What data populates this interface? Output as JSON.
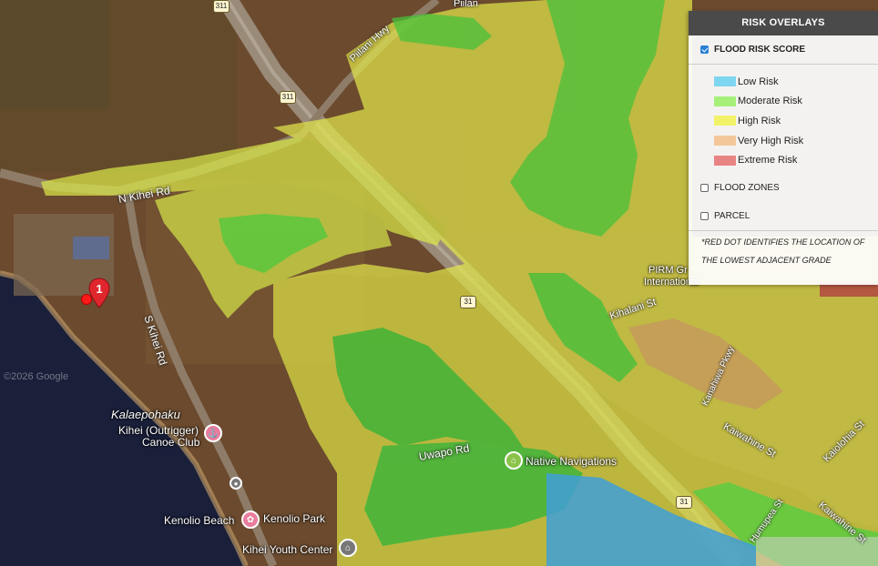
{
  "panel": {
    "title": "RISK OVERLAYS",
    "flood_risk": {
      "label": "FLOOD RISK SCORE",
      "checked": true
    },
    "legend": [
      {
        "label": "Low Risk",
        "color": "#7fd6f0"
      },
      {
        "label": "Moderate Risk",
        "color": "#a6f07a"
      },
      {
        "label": "High Risk",
        "color": "#f2f26a"
      },
      {
        "label": "Very High Risk",
        "color": "#f4c79a"
      },
      {
        "label": "Extreme Risk",
        "color": "#e98484"
      }
    ],
    "flood_zones": {
      "label": "FLOOD ZONES",
      "checked": false
    },
    "parcel": {
      "label": "PARCEL",
      "checked": false
    },
    "note_line1": "*RED DOT IDENTIFIES THE LOCATION OF",
    "note_line2": "THE LOWEST ADJACENT GRADE"
  },
  "map": {
    "marker_number": "1",
    "google_attribution": "©2026 Google",
    "place_labels": {
      "kalaepohaku": "Kalaepohaku",
      "canoe_club": "Kihei (Outrigger) Canoe Club",
      "canoe_club_line1": "Kihei (Outrigger)",
      "canoe_club_line2": "Canoe Club",
      "kenolio_beach": "Kenolio Beach",
      "kenolio_park": "Kenolio Park",
      "youth_center": "Kihei Youth Center",
      "native_navigations": "Native Navigations",
      "pirm": "PIRM Gr... International",
      "pirm_line1": "PIRM Gr",
      "pirm_line2": "International"
    },
    "roads": {
      "piilani_hwy": "Piilani Hwy",
      "piilani_top": "Piilan",
      "n_kihei_rd": "N Kihei Rd",
      "s_kihei_rd": "S Kihei Rd",
      "uwapo_rd": "Uwapo Rd",
      "kihalani": "Kihalani St",
      "kanahiwa": "Kanahiwa Pkwy",
      "kaiwahine1": "Kaiwahine St",
      "kaiwahine2": "Kaiwahine St",
      "kaiolohia": "Kaiolohia St",
      "humupea": "Humupea St"
    },
    "route_shields": {
      "s311": "311",
      "s311top": "311",
      "s31": "31",
      "s31b": "31"
    }
  }
}
